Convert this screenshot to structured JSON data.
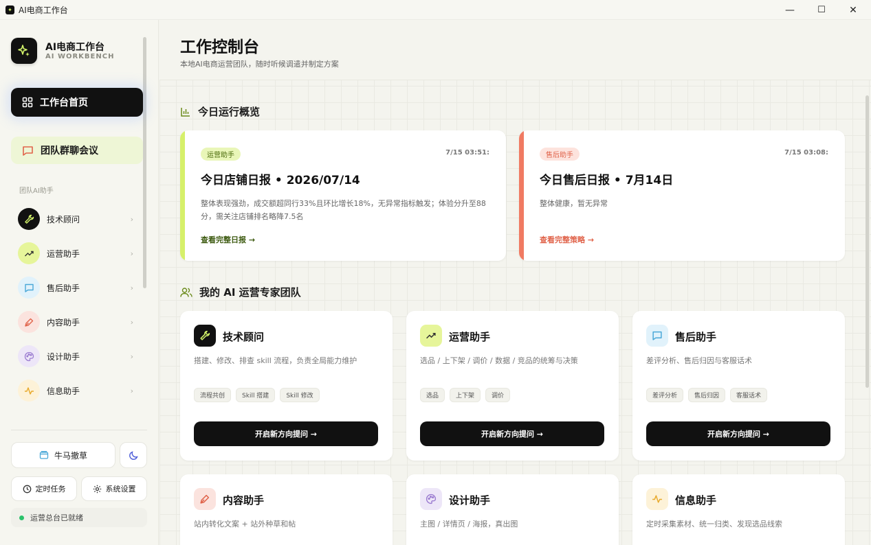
{
  "window": {
    "title": "AI电商工作台",
    "controls": {
      "minimize": "—",
      "maximize": "☐",
      "close": "✕"
    }
  },
  "brand": {
    "name": "AI电商工作台",
    "subtitle": "AI WORKBENCH"
  },
  "nav": {
    "home": "工作台首页",
    "group_chat": "团队群聊会议",
    "section_label": "团队AI助手",
    "agents": [
      {
        "label": "技术顾问",
        "icon": "wrench-icon",
        "color": "#111111"
      },
      {
        "label": "运营助手",
        "icon": "trending-icon",
        "color": "#e6f59a"
      },
      {
        "label": "售后助手",
        "icon": "chat-icon",
        "color": "#e1f2fb"
      },
      {
        "label": "内容助手",
        "icon": "pen-icon",
        "color": "#fbe3de"
      },
      {
        "label": "设计助手",
        "icon": "palette-icon",
        "color": "#ede6f8"
      },
      {
        "label": "信息助手",
        "icon": "pulse-icon",
        "color": "#fdf2d8"
      }
    ],
    "chevron": "›"
  },
  "footer": {
    "niuma": "牛马撤草",
    "scheduled": "定时任务",
    "settings": "系统设置",
    "status": "运营总台已就绪"
  },
  "header": {
    "title": "工作控制台",
    "subtitle": "本地AI电商运营团队，随时听候调遣并制定方案"
  },
  "overview": {
    "title": "今日运行概览",
    "cards": [
      {
        "badge": "运营助手",
        "time": "7/15 03:51:",
        "title": "今日店铺日报 • 2026/07/14",
        "desc": "整体表现强劲，成交额超同行33%且环比增长18%，无异常指标触发；体验分升至88分，需关注店铺排名略降7.5名",
        "link": "查看完整日报 →",
        "accent": "#d6f06a",
        "badge_bg": "#e9f6b8",
        "badge_fg": "#4a6a0a",
        "link_fg": "#3d5a10"
      },
      {
        "badge": "售后助手",
        "time": "7/15 03:08:",
        "title": "今日售后日报 • 7月14日",
        "desc": "整体健康，暂无异常",
        "link": "查看完整策略 →",
        "accent": "#f07a62",
        "badge_bg": "#fde3dd",
        "badge_fg": "#e0634a",
        "link_fg": "#e0634a"
      }
    ]
  },
  "team": {
    "title": "我的 AI 运营专家团队",
    "cta": "开启新方向提问 →",
    "cards": [
      {
        "name": "技术顾问",
        "desc": "搭建、修改、排查 skill 流程，负责全局能力维护",
        "tags": [
          "流程共创",
          "Skill 搭建",
          "Skill 修改"
        ],
        "icon": "wrench-icon",
        "bg": "#111111"
      },
      {
        "name": "运营助手",
        "desc": "选品 / 上下架 / 调价 / 数据 / 竞品的统筹与决策",
        "tags": [
          "选品",
          "上下架",
          "调价"
        ],
        "icon": "trending-icon",
        "bg": "#e6f59a"
      },
      {
        "name": "售后助手",
        "desc": "差评分析、售后归因与客服话术",
        "tags": [
          "差评分析",
          "售后归因",
          "客服话术"
        ],
        "icon": "chat-icon",
        "bg": "#e1f2fb"
      },
      {
        "name": "内容助手",
        "desc": "站内转化文案 + 站外种草和帖",
        "tags": [],
        "icon": "pen-icon",
        "bg": "#fbe3de"
      },
      {
        "name": "设计助手",
        "desc": "主图 / 详情页 / 海报，真出图",
        "tags": [],
        "icon": "palette-icon",
        "bg": "#ede6f8"
      },
      {
        "name": "信息助手",
        "desc": "定时采集素材、统一归类、发现选品线索",
        "tags": [],
        "icon": "pulse-icon",
        "bg": "#fdf2d8"
      }
    ]
  }
}
